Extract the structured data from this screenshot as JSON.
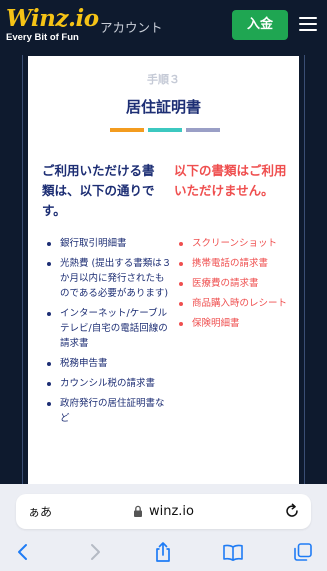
{
  "header": {
    "logo_text": "Winz.io",
    "logo_tagline": "Every Bit of Fun",
    "account_label": "アカウント",
    "deposit_label": "入金",
    "menu_icon": "hamburger-menu-icon"
  },
  "card": {
    "step_label": "手順３",
    "title": "居住証明書",
    "bar_colors": [
      "#f39c1f",
      "#3cc8c0",
      "#9a9fc6"
    ],
    "accepted": {
      "heading": "ご利用いただける書類は、以下の通りです。",
      "items": [
        "銀行取引明細書",
        "光熱費 (提出する書類は３か月以内に発行されたものである必要があります)",
        "インターネット/ケーブルテレビ/自宅の電話回線の請求書",
        "税務申告書",
        "カウンシル税の請求書",
        "政府発行の居住証明書など"
      ]
    },
    "rejected": {
      "heading": "以下の書類はご利用いただけません。",
      "items": [
        "スクリーンショット",
        "携帯電話の請求書",
        "医療費の請求書",
        "商品購入時のレシート",
        "保険明細書"
      ]
    }
  },
  "browser": {
    "text_size_label": "ぁあ",
    "url": "winz.io",
    "lock_icon": "lock-icon",
    "reload_icon": "reload-icon",
    "toolbar_icons": [
      "back-icon",
      "forward-icon",
      "share-icon",
      "bookmarks-icon",
      "tabs-icon"
    ]
  }
}
